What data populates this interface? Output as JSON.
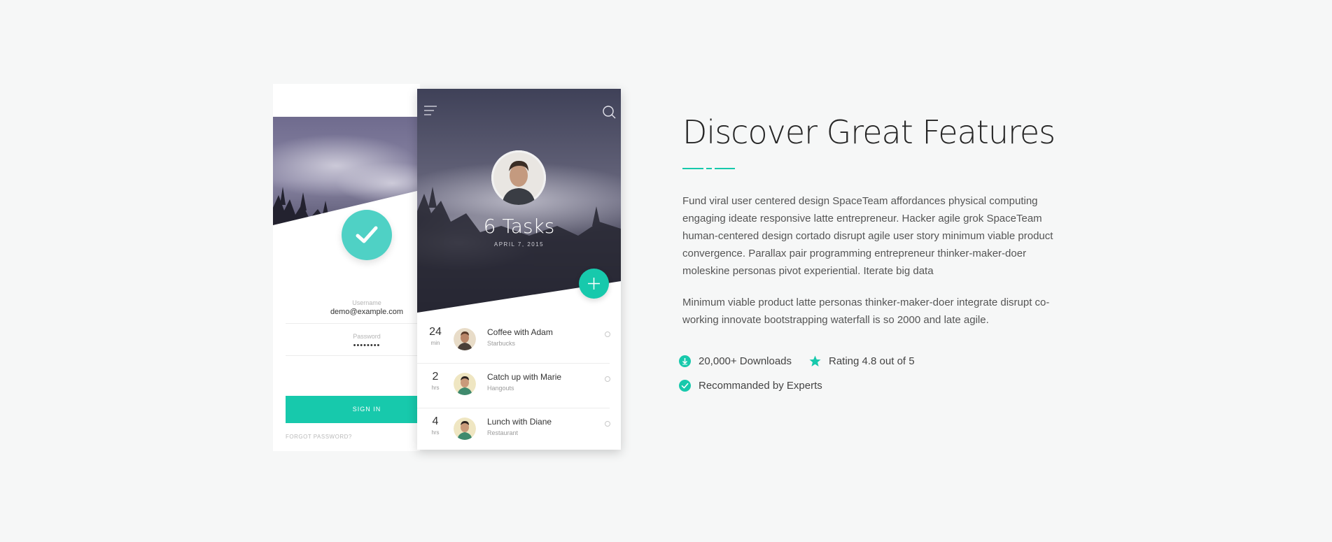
{
  "login_phone": {
    "username_label": "Username",
    "username_value": "demo@example.com",
    "password_label": "Password",
    "password_value": "••••••••",
    "signin_label": "SIGN IN",
    "forgot_label": "FORGOT PASSWORD?"
  },
  "tasks_phone": {
    "title": "6 Tasks",
    "date": "APRIL 7, 2015",
    "tasks": [
      {
        "num": "24",
        "unit": "min",
        "title": "Coffee with Adam",
        "sub": "Starbucks"
      },
      {
        "num": "2",
        "unit": "hrs",
        "title": "Catch up with Marie",
        "sub": "Hangouts"
      },
      {
        "num": "4",
        "unit": "hrs",
        "title": "Lunch with Diane",
        "sub": "Restaurant"
      }
    ]
  },
  "content": {
    "heading": "Discover Great Features",
    "paragraph_1": "Fund viral user centered design SpaceTeam affordances physical computing engaging ideate responsive latte entrepreneur. Hacker agile grok SpaceTeam human-centered design cortado disrupt agile user story minimum viable product convergence. Parallax pair programming entrepreneur thinker-maker-doer moleskine personas pivot experiential. Iterate big data",
    "paragraph_2": "Minimum viable product latte personas thinker-maker-doer integrate disrupt co-working innovate bootstrapping waterfall is so 2000 and late agile.",
    "bullets": {
      "downloads": "20,000+ Downloads",
      "rating": "Rating 4.8 out of 5",
      "recommended": "Recommanded by Experts"
    }
  },
  "colors": {
    "accent": "#17c9ac",
    "check_circle": "#4fd1c5",
    "background": "#f6f7f7"
  },
  "icons": [
    "check-icon",
    "menu-icon",
    "search-icon",
    "plus-icon",
    "download-icon",
    "star-icon",
    "check-circle-icon"
  ]
}
